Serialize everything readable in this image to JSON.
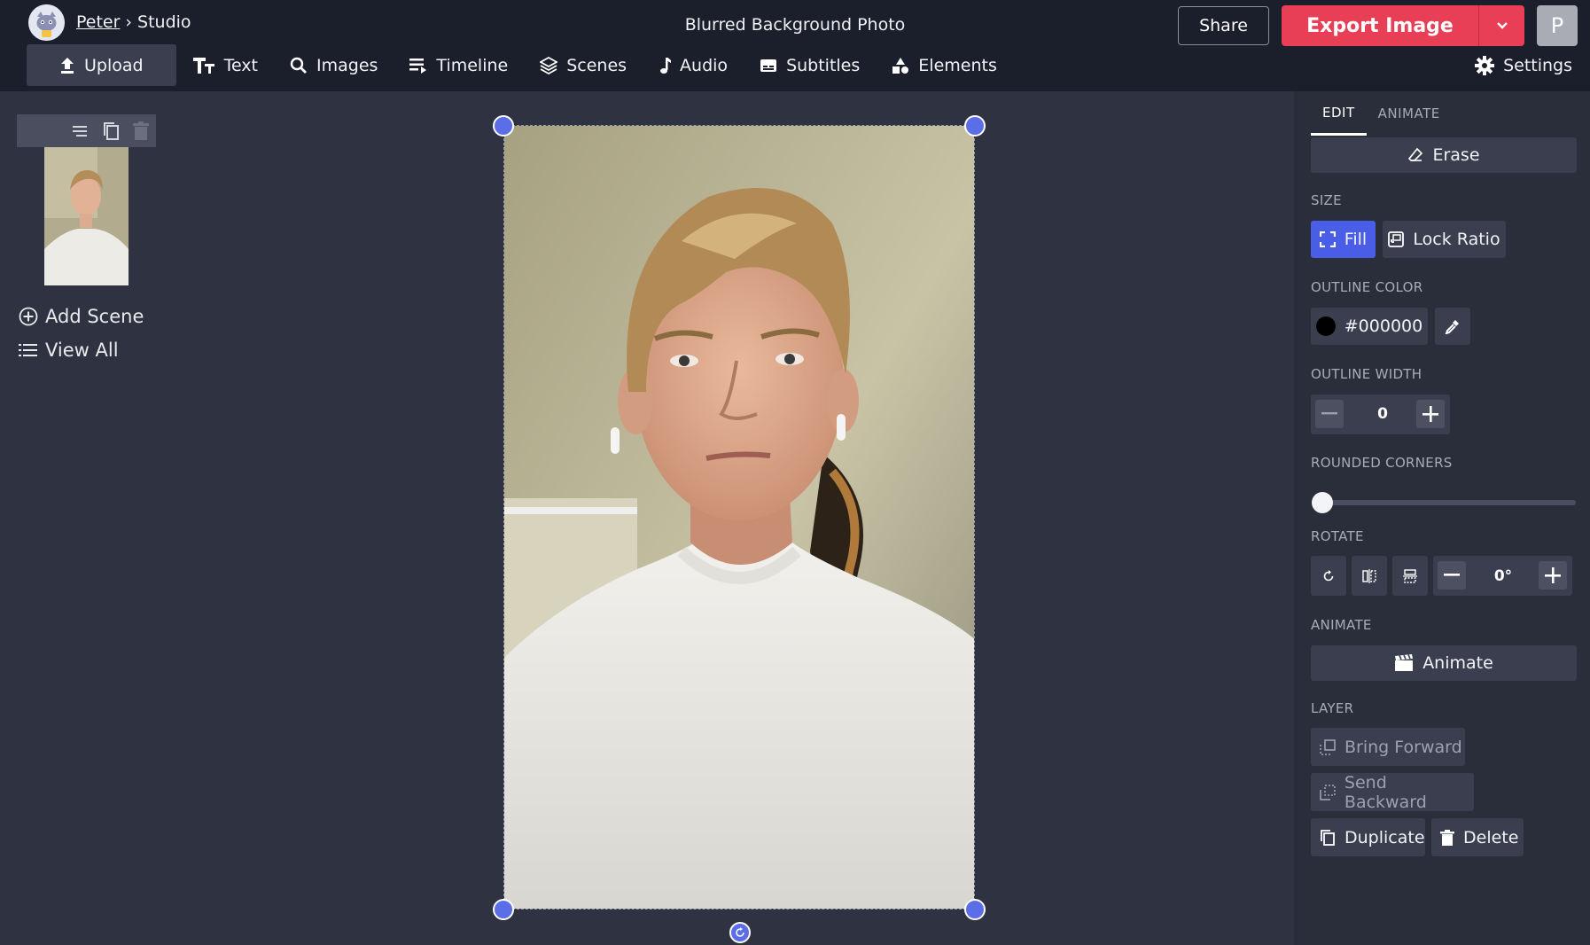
{
  "header": {
    "user_link": "Peter",
    "separator": "›",
    "section": "Studio",
    "document_title": "Blurred Background Photo",
    "share_label": "Share",
    "export_label": "Export Image",
    "avatar_initial": "P"
  },
  "toolbar": {
    "items": [
      {
        "label": "Upload",
        "icon": "upload-icon"
      },
      {
        "label": "Text",
        "icon": "text-icon"
      },
      {
        "label": "Images",
        "icon": "search-icon"
      },
      {
        "label": "Timeline",
        "icon": "timeline-icon"
      },
      {
        "label": "Scenes",
        "icon": "layers-icon"
      },
      {
        "label": "Audio",
        "icon": "music-note-icon"
      },
      {
        "label": "Subtitles",
        "icon": "subtitles-icon"
      },
      {
        "label": "Elements",
        "icon": "shapes-icon"
      }
    ],
    "settings_label": "Settings"
  },
  "scenes": {
    "add_scene_label": "Add Scene",
    "view_all_label": "View All"
  },
  "panel": {
    "tabs": [
      "EDIT",
      "ANIMATE"
    ],
    "erase_label": "Erase",
    "size_label": "SIZE",
    "fill_label": "Fill",
    "lock_ratio_label": "Lock Ratio",
    "outline_color_label": "OUTLINE COLOR",
    "outline_color_value": "#000000",
    "outline_width_label": "OUTLINE WIDTH",
    "outline_width_value": "0",
    "rounded_corners_label": "ROUNDED CORNERS",
    "rounded_corners_value": 0,
    "rotate_label": "ROTATE",
    "rotate_value": "0°",
    "animate_section_label": "ANIMATE",
    "animate_button_label": "Animate",
    "layer_label": "LAYER",
    "bring_forward_label": "Bring Forward",
    "send_backward_label": "Send Backward",
    "duplicate_label": "Duplicate",
    "delete_label": "Delete"
  },
  "colors": {
    "accent": "#e83f57",
    "selection": "#5b6ee8",
    "fill_active": "#4a5de6",
    "outline_swatch": "#000000"
  }
}
